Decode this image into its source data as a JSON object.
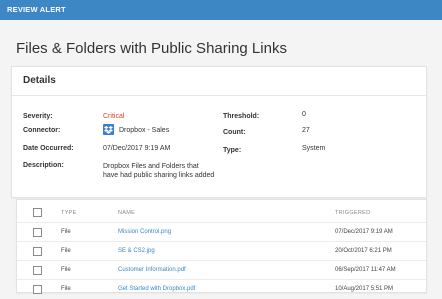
{
  "header": {
    "title": "REVIEW ALERT"
  },
  "page": {
    "title": "Files & Folders with Public Sharing Links"
  },
  "details": {
    "heading": "Details",
    "severity_label": "Severity:",
    "severity_value": "Critical",
    "connector_label": "Connector:",
    "connector_value": "Dropbox - Sales",
    "date_label": "Date Occurred:",
    "date_value": "07/Dec/2017 9:19 AM",
    "description_label": "Description:",
    "description_value": "Dropbox Files and Folders that have had public sharing links added",
    "threshold_label": "Threshold:",
    "threshold_value": "0",
    "count_label": "Count:",
    "count_value": "27",
    "type_label": "Type:",
    "type_value": "System"
  },
  "colors": {
    "header_bg": "#3d87c4",
    "critical": "#d9442c",
    "link": "#3d87c4"
  },
  "table": {
    "columns": [
      "TYPE",
      "NAME",
      "TRIGGERED"
    ],
    "rows": [
      {
        "type": "File",
        "name": "Mission Control.png",
        "triggered": "07/Dec/2017 9:19 AM"
      },
      {
        "type": "File",
        "name": "SE & CS2.jpg",
        "triggered": "20/Oct/2017 6:21 PM"
      },
      {
        "type": "File",
        "name": "Customer Information.pdf",
        "triggered": "06/Sep/2017 11:47 AM"
      },
      {
        "type": "File",
        "name": "Get Started with Dropbox.pdf",
        "triggered": "10/Aug/2017 5:51 PM"
      }
    ]
  }
}
